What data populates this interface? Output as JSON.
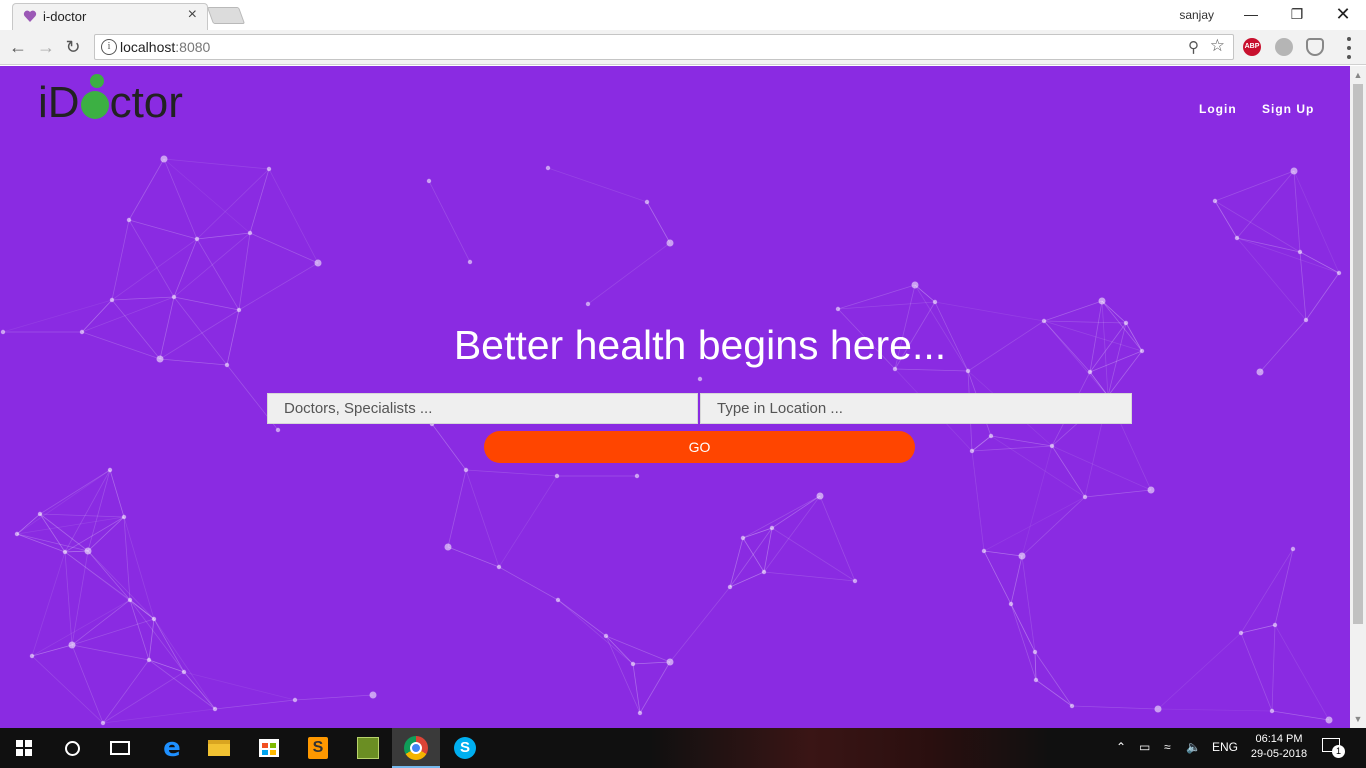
{
  "browser": {
    "tab_title": "i-doctor",
    "profile_name": "sanjay",
    "url_host": "localhost",
    "url_port": ":8080",
    "extension_abp": "ABP"
  },
  "site": {
    "logo_prefix": "iD",
    "logo_suffix": "ctor",
    "nav": {
      "login": "Login",
      "signup": "Sign Up"
    },
    "hero_title": "Better health begins here...",
    "search": {
      "doctor_placeholder": "Doctors, Specialists ...",
      "location_placeholder": "Type in Location ..."
    },
    "go_label": "GO",
    "colors": {
      "background": "#8a2be2",
      "go_button": "#ff4500",
      "logo_green": "#3cb043"
    }
  },
  "taskbar": {
    "language": "ENG",
    "time": "06:14 PM",
    "date": "29-05-2018",
    "notification_count": "1",
    "apps": [
      "start-icon",
      "cortana-icon",
      "task-view-icon",
      "edge-icon",
      "file-explorer-icon",
      "store-icon",
      "sublime-text-icon",
      "tool-icon",
      "chrome-icon",
      "skype-icon"
    ]
  }
}
